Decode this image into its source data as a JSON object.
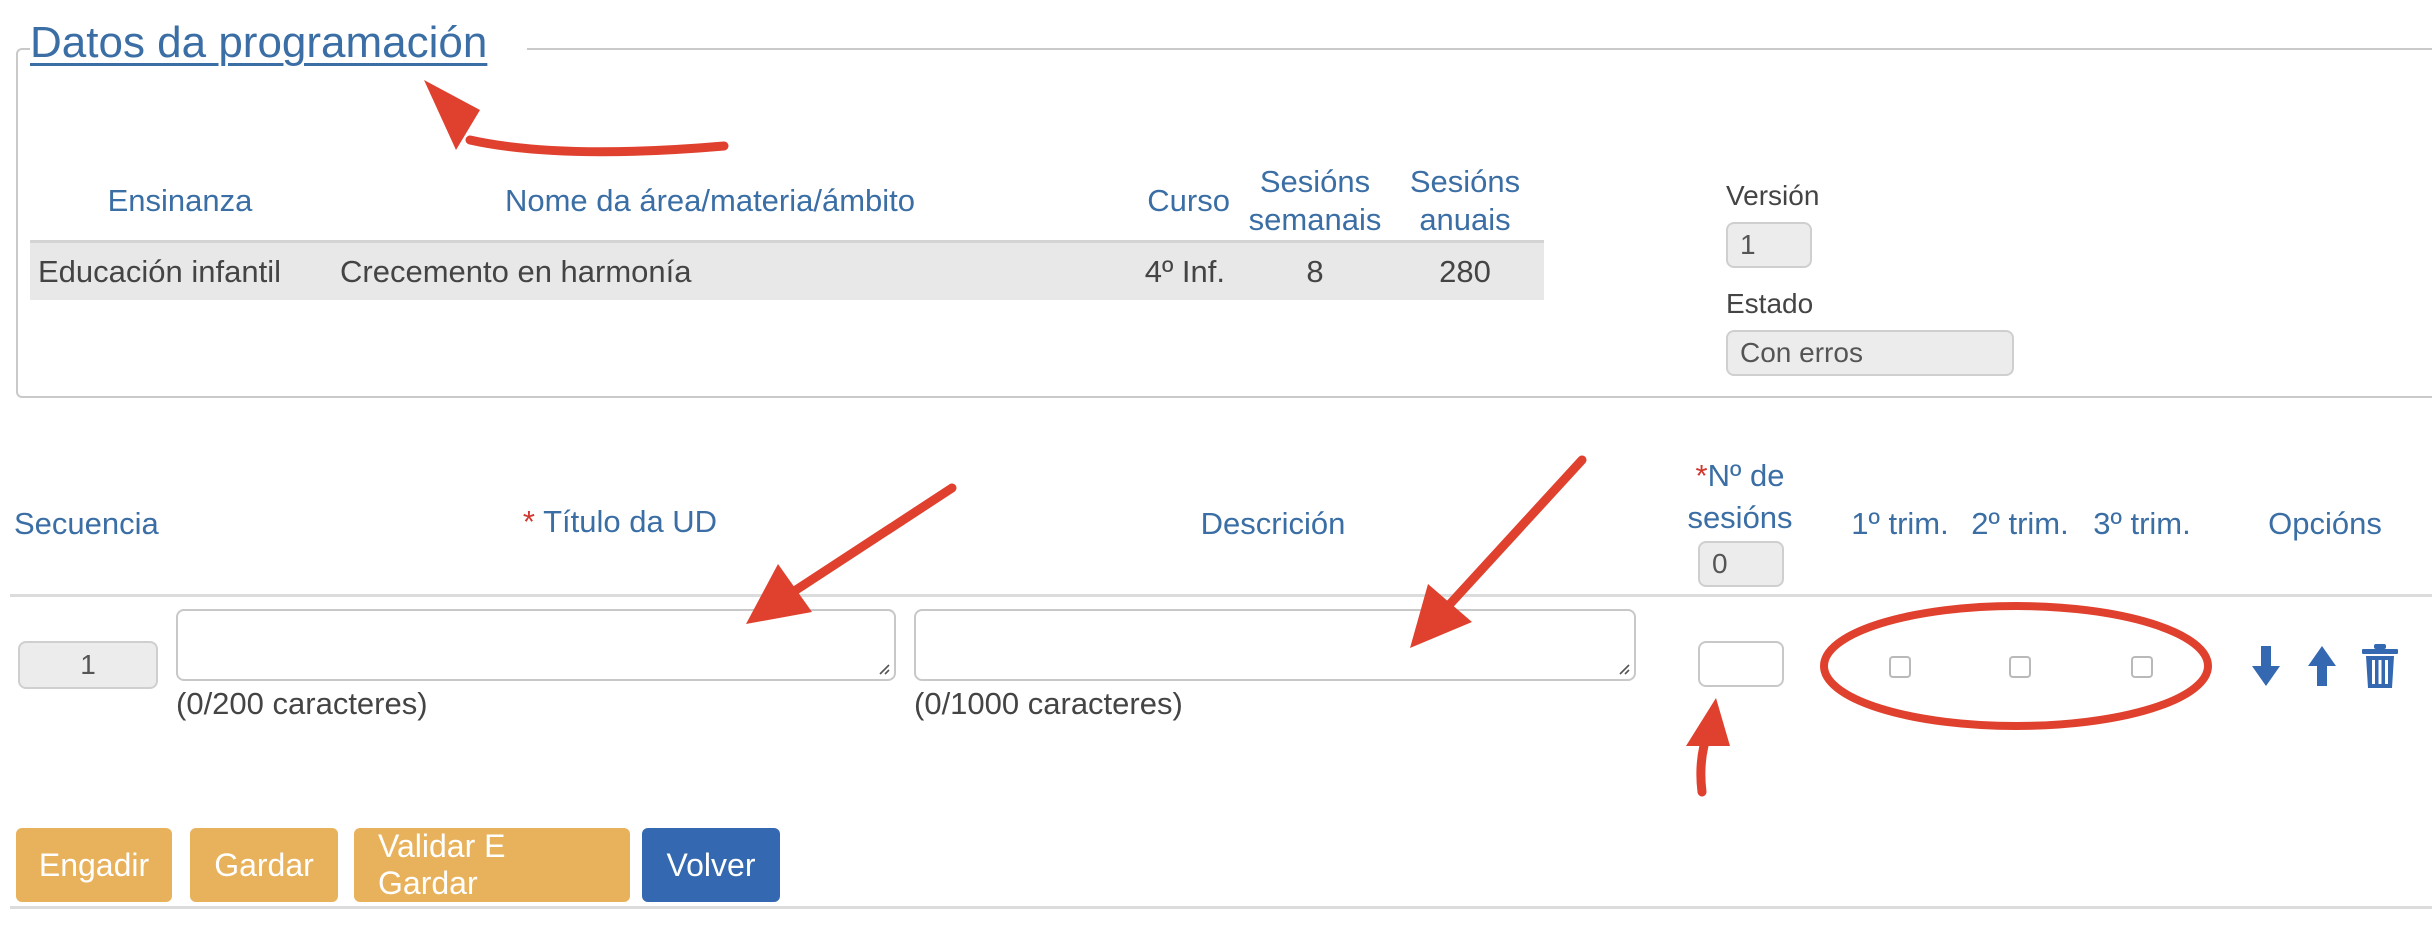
{
  "section": {
    "legend": "Datos da programación"
  },
  "course_table": {
    "headers": {
      "ensinanza": "Ensinanza",
      "nome": "Nome da área/materia/ámbito",
      "curso": "Curso",
      "sesions_semanais": [
        "Sesións",
        "semanais"
      ],
      "sesions_anuais": [
        "Sesións",
        "anuais"
      ]
    },
    "row": {
      "ensinanza": "Educación infantil",
      "nome": "Crecemento en harmonía",
      "curso": "4º Inf.",
      "sesions_semanais": "8",
      "sesions_anuais": "280"
    }
  },
  "meta": {
    "version_label": "Versión",
    "version_value": "1",
    "estado_label": "Estado",
    "estado_value": "Con erros"
  },
  "units_table": {
    "headers": {
      "secuencia": "Secuencia",
      "titulo_required": "*",
      "titulo": "Título da UD",
      "descricion": "Descrición",
      "sesions_required": "*",
      "sesions_line1": "Nº de",
      "sesions_line2": "sesións",
      "sesions_total": "0",
      "trim1": "1º trim.",
      "trim2": "2º trim.",
      "trim3": "3º trim.",
      "opcions": "Opcións"
    },
    "row": {
      "secuencia": "1",
      "titulo_value": "",
      "titulo_counter": "(0/200 caracteres)",
      "descricion_value": "",
      "descricion_counter": "(0/1000 caracteres)",
      "sesions_value": "",
      "trim1_checked": false,
      "trim2_checked": false,
      "trim3_checked": false
    }
  },
  "buttons": {
    "engadir": "Engadir",
    "gardar": "Gardar",
    "validar": "Validar E Gardar",
    "volver": "Volver"
  },
  "icons": {
    "move_down": "arrow-down-icon",
    "move_up": "arrow-up-icon",
    "delete": "trash-icon"
  },
  "colors": {
    "heading_blue": "#3a6ea5",
    "button_orange": "#e8b25c",
    "button_blue": "#3468b0",
    "annotation_red": "#e0412e",
    "required_red": "#d0372e"
  }
}
